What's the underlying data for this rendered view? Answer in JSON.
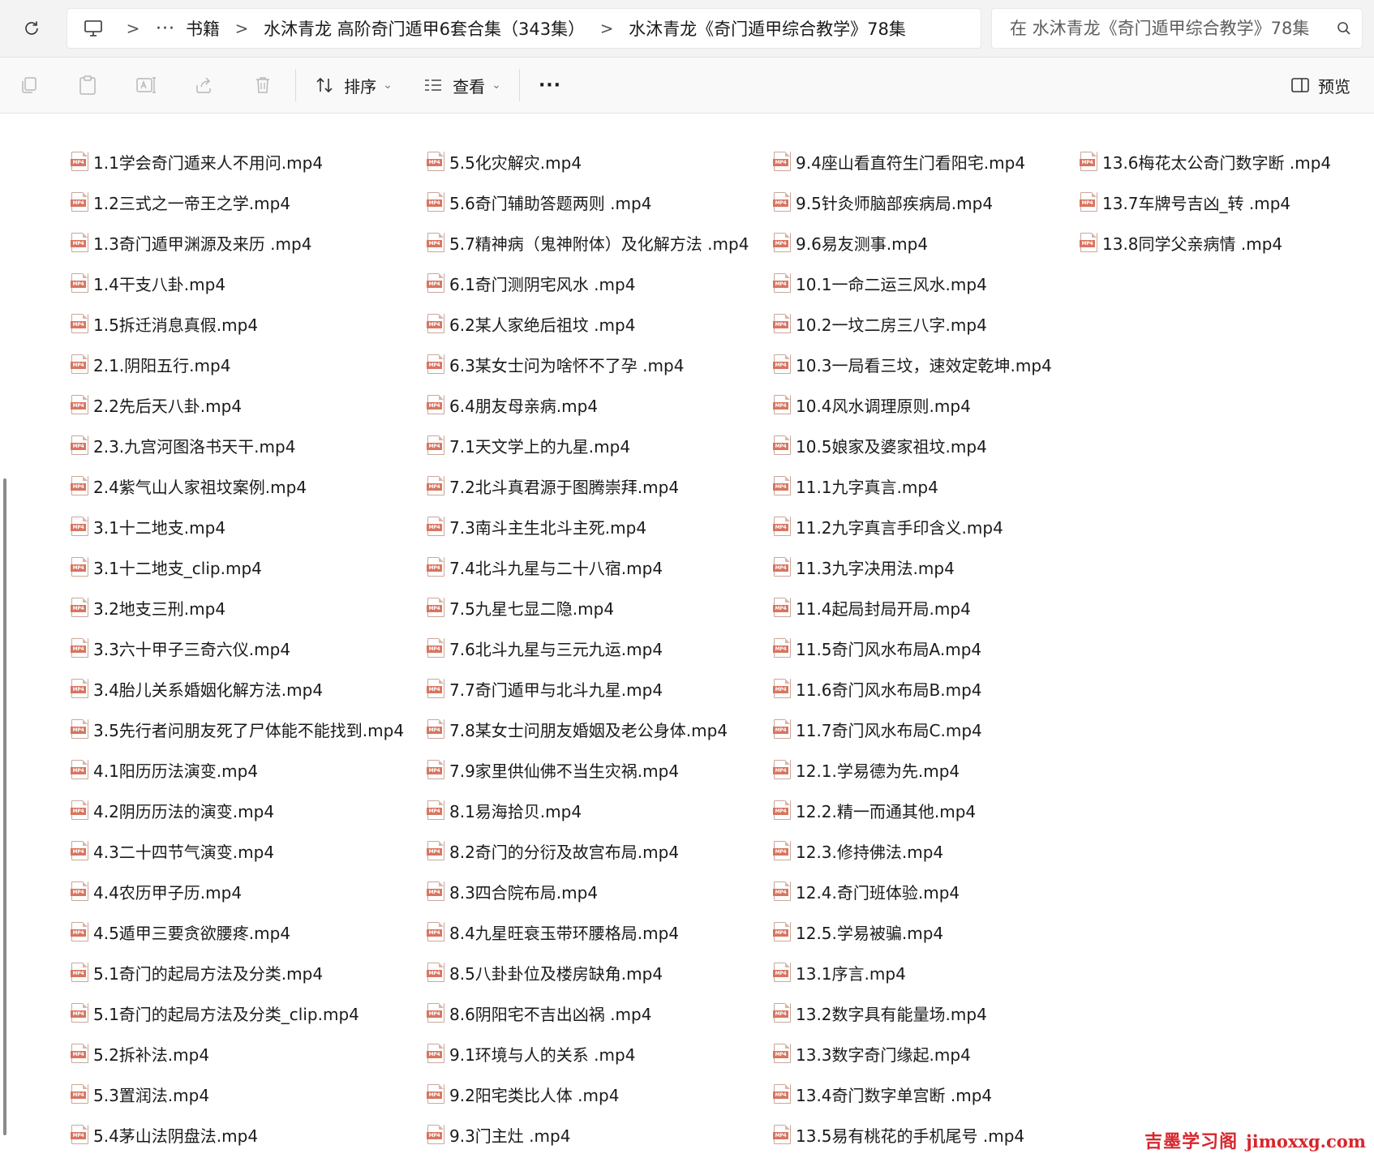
{
  "address_bar": {
    "breadcrumb": [
      "书籍",
      "水沐青龙 高阶奇门遁甲6套合集（343集）",
      "水沐青龙《奇门遁甲综合教学》78集"
    ],
    "more_label": "···",
    "separator": ">",
    "search_placeholder": "在 水沐青龙《奇门遁甲综合教学》78集"
  },
  "toolbar": {
    "sort_label": "排序",
    "view_label": "查看",
    "more_label": "···",
    "preview_label": "预览",
    "caret": "⌄"
  },
  "file_icon_tag": "MP4",
  "files": {
    "col1": [
      "1.1学会奇门遁来人不用问.mp4",
      "1.2三式之一帝王之学.mp4",
      "1.3奇门遁甲渊源及来历 .mp4",
      "1.4干支八卦.mp4",
      "1.5拆迁消息真假.mp4",
      "2.1.阴阳五行.mp4",
      "2.2先后天八卦.mp4",
      "2.3.九宫河图洛书天干.mp4",
      "2.4紫气山人家祖坟案例.mp4",
      "3.1十二地支.mp4",
      "3.1十二地支_clip.mp4",
      "3.2地支三刑.mp4",
      "3.3六十甲子三奇六仪.mp4",
      "3.4胎儿关系婚姻化解方法.mp4",
      "3.5先行者问朋友死了尸体能不能找到.mp4",
      "4.1阳历历法演变.mp4",
      "4.2阴历历法的演变.mp4",
      "4.3二十四节气演变.mp4",
      "4.4农历甲子历.mp4",
      "4.5遁甲三要贪欲腰疼.mp4",
      "5.1奇门的起局方法及分类.mp4",
      "5.1奇门的起局方法及分类_clip.mp4",
      "5.2拆补法.mp4",
      "5.3置润法.mp4",
      "5.4茅山法阴盘法.mp4"
    ],
    "col2": [
      "5.5化灾解灾.mp4",
      "5.6奇门辅助答题两则 .mp4",
      "5.7精神病（鬼神附体）及化解方法 .mp4",
      "6.1奇门测阴宅风水 .mp4",
      "6.2某人家绝后祖坟 .mp4",
      "6.3某女士问为啥怀不了孕 .mp4",
      "6.4朋友母亲病.mp4",
      "7.1天文学上的九星.mp4",
      "7.2北斗真君源于图腾崇拜.mp4",
      "7.3南斗主生北斗主死.mp4",
      "7.4北斗九星与二十八宿.mp4",
      "7.5九星七显二隐.mp4",
      "7.6北斗九星与三元九运.mp4",
      "7.7奇门遁甲与北斗九星.mp4",
      "7.8某女士问朋友婚姻及老公身体.mp4",
      "7.9家里供仙佛不当生灾祸.mp4",
      "8.1易海拾贝.mp4",
      "8.2奇门的分衍及故宫布局.mp4",
      "8.3四合院布局.mp4",
      "8.4九星旺衰玉带环腰格局.mp4",
      "8.5八卦卦位及楼房缺角.mp4",
      "8.6阴阳宅不吉出凶祸 .mp4",
      "9.1环境与人的关系 .mp4",
      "9.2阳宅类比人体 .mp4",
      "9.3门主灶 .mp4"
    ],
    "col3": [
      "9.4座山看直符生门看阳宅.mp4",
      "9.5针灸师脑部疾病局.mp4",
      "9.6易友测事.mp4",
      "10.1一命二运三风水.mp4",
      "10.2一坟二房三八字.mp4",
      "10.3一局看三坟，速效定乾坤.mp4",
      "10.4风水调理原则.mp4",
      "10.5娘家及婆家祖坟.mp4",
      "11.1九字真言.mp4",
      "11.2九字真言手印含义.mp4",
      "11.3九字决用法.mp4",
      "11.4起局封局开局.mp4",
      "11.5奇门风水布局A.mp4",
      "11.6奇门风水布局B.mp4",
      "11.7奇门风水布局C.mp4",
      "12.1.学易德为先.mp4",
      "12.2.精一而通其他.mp4",
      "12.3.修持佛法.mp4",
      "12.4.奇门班体验.mp4",
      "12.5.学易被骗.mp4",
      "13.1序言.mp4",
      "13.2数字具有能量场.mp4",
      "13.3数字奇门缘起.mp4",
      "13.4奇门数字单宫断 .mp4",
      "13.5易有桃花的手机尾号 .mp4"
    ],
    "col4": [
      "13.6梅花太公奇门数字断 .mp4",
      "13.7车牌号吉凶_转 .mp4",
      "13.8同学父亲病情 .mp4"
    ]
  },
  "watermark": {
    "cn": "吉墨学习阁",
    "en": "jimoxxg.com"
  }
}
